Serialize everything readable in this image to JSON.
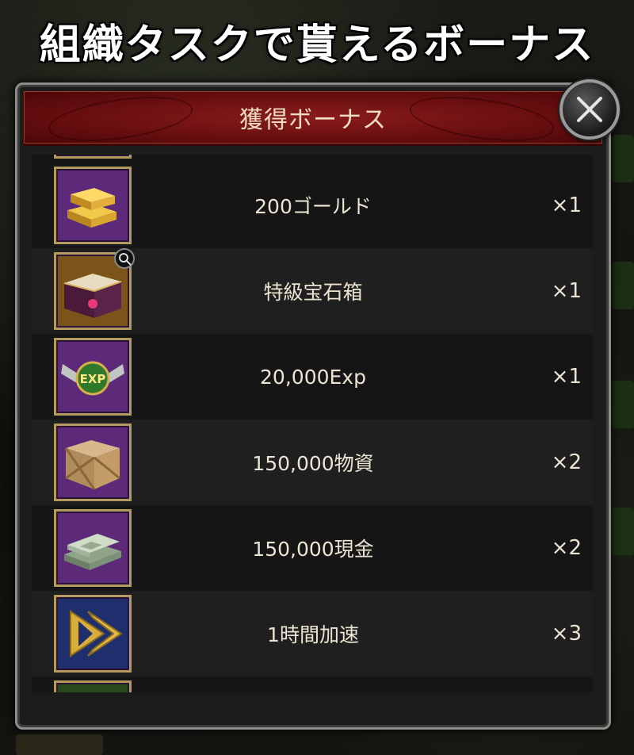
{
  "headline": "組織タスクで貰えるボーナス",
  "dialog": {
    "title": "獲得ボーナス",
    "close_icon": "close-x-icon"
  },
  "items": [
    {
      "name": "200ゴールド",
      "qty": "×1",
      "icon": "gold-bars-icon"
    },
    {
      "name": "特級宝石箱",
      "qty": "×1",
      "icon": "jewel-chest-icon"
    },
    {
      "name": "20,000Exp",
      "qty": "×1",
      "icon": "exp-badge-icon",
      "icon_text": "EXP"
    },
    {
      "name": "150,000物資",
      "qty": "×2",
      "icon": "wooden-crate-icon"
    },
    {
      "name": "150,000現金",
      "qty": "×2",
      "icon": "cash-stack-icon"
    },
    {
      "name": "1時間加速",
      "qty": "×3",
      "icon": "speedup-arrow-icon"
    }
  ],
  "colors": {
    "header_red": "#6a0f10",
    "thumb_purple": "#5c2a78",
    "thumb_blue": "#1f2f6e",
    "frame_gold": "#b39a5e",
    "text": "#ece4d2"
  }
}
